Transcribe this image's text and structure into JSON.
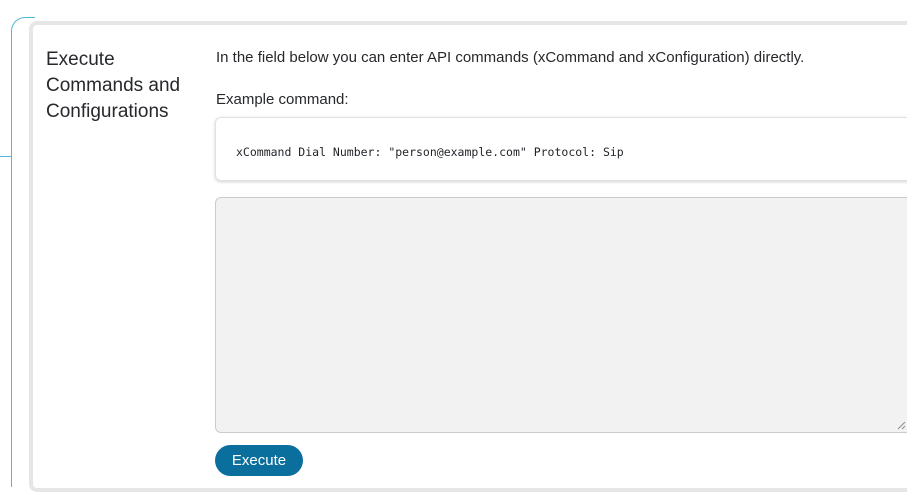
{
  "section": {
    "title": "Execute Commands and Configurations"
  },
  "intro_text": "In the field below you can enter API commands (xCommand and xConfiguration) directly.",
  "example": {
    "label": "Example command:",
    "code": "xCommand Dial Number: \"person@example.com\" Protocol: Sip"
  },
  "command_input": {
    "value": "",
    "placeholder": ""
  },
  "execute_button": {
    "label": "Execute"
  },
  "colors": {
    "accent": "#4fb7d8",
    "button": "#0a6f9d",
    "input_bg": "#f2f2f2"
  }
}
